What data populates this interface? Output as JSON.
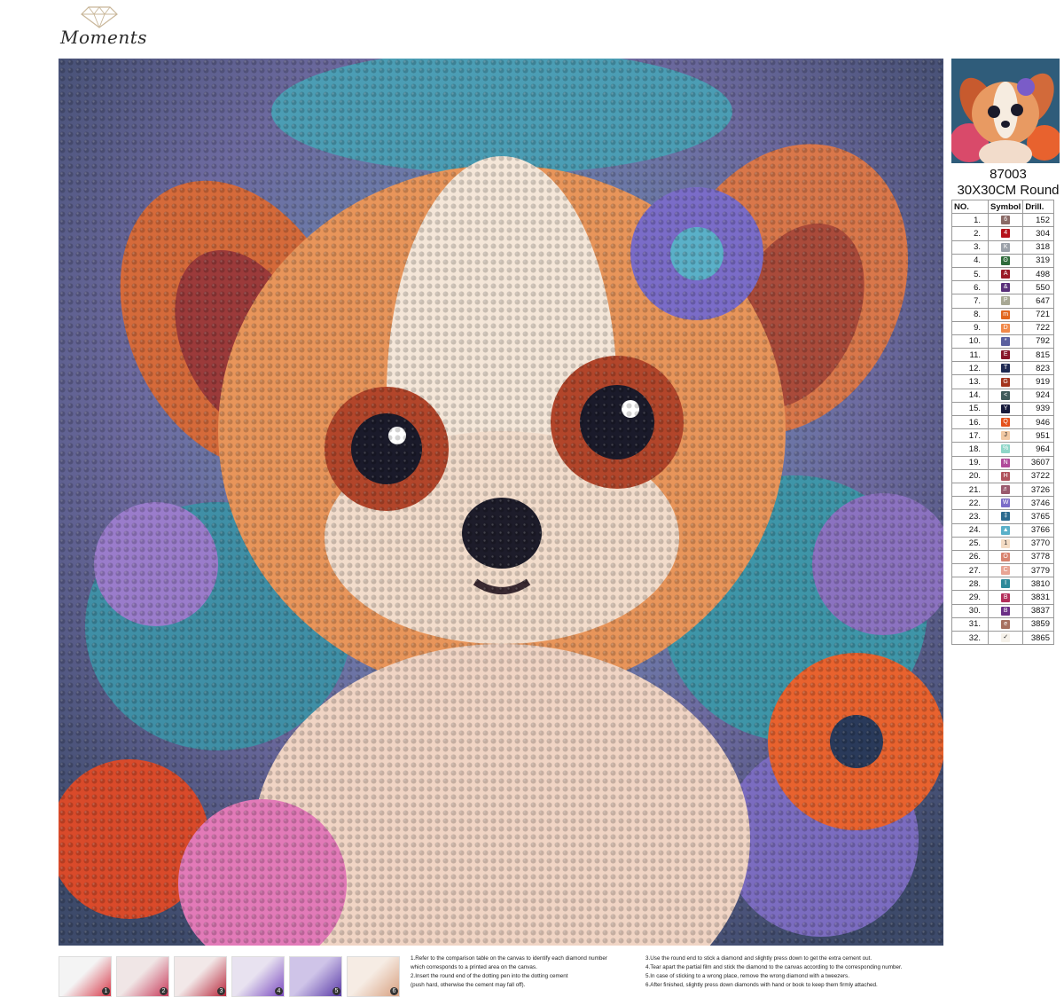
{
  "brand": {
    "logo_text": "Moments",
    "logo_icon": "diamond-gem-icon"
  },
  "kit": {
    "code": "87003",
    "size": "30X30CM Round"
  },
  "legend": {
    "headers": [
      "NO.",
      "Symbol",
      "Drill."
    ],
    "rows": [
      {
        "no": "1.",
        "symbol": "6",
        "drill": "152",
        "color": "#8a6a66"
      },
      {
        "no": "2.",
        "symbol": "4",
        "drill": "304",
        "color": "#b5121b"
      },
      {
        "no": "3.",
        "symbol": "K",
        "drill": "318",
        "color": "#9aa0a8"
      },
      {
        "no": "4.",
        "symbol": "ʘ",
        "drill": "319",
        "color": "#2e6a3a"
      },
      {
        "no": "5.",
        "symbol": "A",
        "drill": "498",
        "color": "#9b1b26"
      },
      {
        "no": "6.",
        "symbol": "&",
        "drill": "550",
        "color": "#5a2f7a"
      },
      {
        "no": "7.",
        "symbol": "P",
        "drill": "647",
        "color": "#a8a894"
      },
      {
        "no": "8.",
        "symbol": "m",
        "drill": "721",
        "color": "#e2661d"
      },
      {
        "no": "9.",
        "symbol": "D",
        "drill": "722",
        "color": "#f1894a"
      },
      {
        "no": "10.",
        "symbol": "*",
        "drill": "792",
        "color": "#5a5f9e"
      },
      {
        "no": "11.",
        "symbol": "E",
        "drill": "815",
        "color": "#87152a"
      },
      {
        "no": "12.",
        "symbol": "T",
        "drill": "823",
        "color": "#1f2a52"
      },
      {
        "no": "13.",
        "symbol": "G",
        "drill": "919",
        "color": "#a3341c"
      },
      {
        "no": "14.",
        "symbol": "<",
        "drill": "924",
        "color": "#3f5a5a"
      },
      {
        "no": "15.",
        "symbol": "Y",
        "drill": "939",
        "color": "#16193a"
      },
      {
        "no": "16.",
        "symbol": "Q",
        "drill": "946",
        "color": "#e4501a"
      },
      {
        "no": "17.",
        "symbol": "J",
        "drill": "951",
        "color": "#f2c9a4"
      },
      {
        "no": "18.",
        "symbol": "%",
        "drill": "964",
        "color": "#8fd6c8"
      },
      {
        "no": "19.",
        "symbol": "N",
        "drill": "3607",
        "color": "#b04a9a"
      },
      {
        "no": "20.",
        "symbol": "H",
        "drill": "3722",
        "color": "#b0525c"
      },
      {
        "no": "21.",
        "symbol": "♬",
        "drill": "3726",
        "color": "#9a5a6e"
      },
      {
        "no": "22.",
        "symbol": "W",
        "drill": "3746",
        "color": "#7a6cc8"
      },
      {
        "no": "23.",
        "symbol": "‡",
        "drill": "3765",
        "color": "#2a6a8e"
      },
      {
        "no": "24.",
        "symbol": "▲",
        "drill": "3766",
        "color": "#5ab0c8"
      },
      {
        "no": "25.",
        "symbol": "1",
        "drill": "3770",
        "color": "#f4dcc4"
      },
      {
        "no": "26.",
        "symbol": "O",
        "drill": "3778",
        "color": "#d8826e"
      },
      {
        "no": "27.",
        "symbol": "C",
        "drill": "3779",
        "color": "#e8a494"
      },
      {
        "no": "28.",
        "symbol": "I",
        "drill": "3810",
        "color": "#2f8a9a"
      },
      {
        "no": "29.",
        "symbol": "B",
        "drill": "3831",
        "color": "#b32e5a"
      },
      {
        "no": "30.",
        "symbol": "B",
        "drill": "3837",
        "color": "#6a2e86"
      },
      {
        "no": "31.",
        "symbol": "e",
        "drill": "3859",
        "color": "#a67060"
      },
      {
        "no": "32.",
        "symbol": "✓",
        "drill": "3865",
        "color": "#f6f2ea"
      }
    ]
  },
  "steps": [
    {
      "num": "1",
      "icon": "legend-chart-photo"
    },
    {
      "num": "2",
      "icon": "dotting-pen-photo"
    },
    {
      "num": "3",
      "icon": "canvas-cement-photo"
    },
    {
      "num": "4",
      "icon": "tweezers-photo"
    },
    {
      "num": "5",
      "icon": "drills-tray-photo"
    },
    {
      "num": "6",
      "icon": "pressing-hand-photo"
    }
  ],
  "instructions_left": [
    "1.Refer to the comparison table on the canvas to identify each diamond number",
    "which corresponds to a printed area on the canvas.",
    "2.Insert the round end of the dotting pen into the dotting cement",
    "(push hard, otherwise the cement may fall off)."
  ],
  "instructions_right": [
    "3.Use the round end to stick a diamond and slightly press down to get the extra cement out.",
    "4.Tear apart the partial film and stick the diamond to the canvas according to the corresponding number.",
    "5.In case of sticking to a wrong place, remove the wrong diamond with a tweezers.",
    "6.After finished, slightly press down diamonds with hand or book to keep them firmly attached."
  ],
  "canvas": {
    "icon": "puppy-diamond-canvas"
  }
}
